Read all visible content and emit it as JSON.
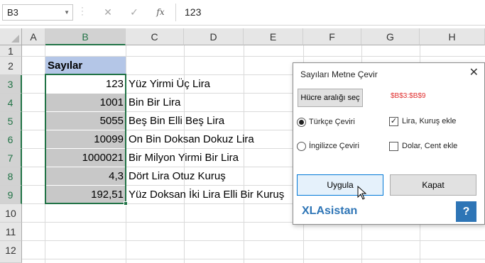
{
  "formula_bar": {
    "name_box": "B3",
    "cancel_icon": "✕",
    "enter_icon": "✓",
    "fx_label": "fx",
    "content": "123"
  },
  "columns": [
    "A",
    "B",
    "C",
    "D",
    "E",
    "F",
    "G",
    "H"
  ],
  "rows": [
    "1",
    "2",
    "3",
    "4",
    "5",
    "6",
    "7",
    "8",
    "9",
    "10",
    "11",
    "12"
  ],
  "sheet": {
    "header": "Sayılar",
    "entries": [
      {
        "number": "123",
        "text": "Yüz Yirmi Üç Lira"
      },
      {
        "number": "1001",
        "text": "Bin Bir Lira"
      },
      {
        "number": "5055",
        "text": "Beş Bin Elli Beş Lira"
      },
      {
        "number": "10099",
        "text": "On Bin Doksan Dokuz Lira"
      },
      {
        "number": "1000021",
        "text": "Bir Milyon Yirmi Bir Lira"
      },
      {
        "number": "4,3",
        "text": "Dört Lira Otuz Kuruş"
      },
      {
        "number": "192,51",
        "text": "Yüz Doksan İki Lira Elli Bir Kuruş"
      }
    ]
  },
  "dialog": {
    "title": "Sayıları Metne Çevir",
    "close_icon": "✕",
    "range_button": "Hücre aralığı seç",
    "range_value": "$B$3:$B$9",
    "turkish_option": "Türkçe Çeviri",
    "english_option": "İngilizce Çeviri",
    "lira_checkbox": "Lira, Kuruş ekle",
    "dollar_checkbox": "Dolar, Cent ekle",
    "apply_button": "Uygula",
    "close_button": "Kapat",
    "brand": "XLAsistan",
    "help_button": "?"
  },
  "colors": {
    "excel_green": "#217346",
    "header_fill": "#b4c6e7",
    "number_fill": "#c8c8c8",
    "range_text": "#e03030",
    "brand": "#2e75b6"
  }
}
